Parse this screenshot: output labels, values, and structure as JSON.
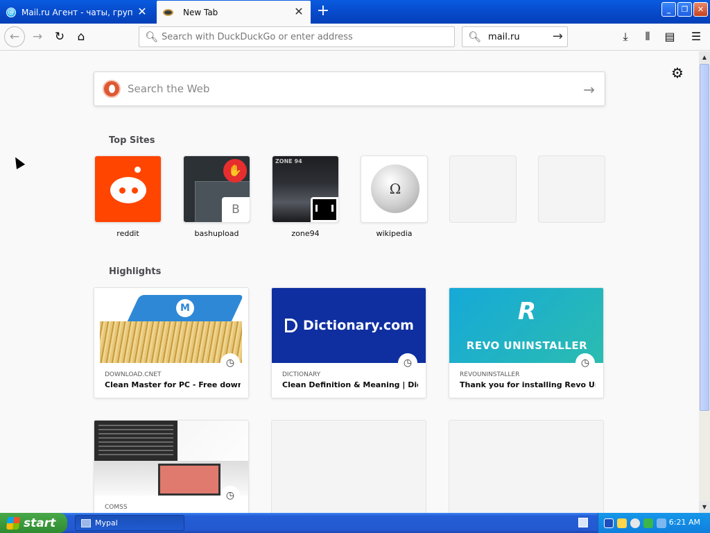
{
  "tabs": [
    {
      "title": "Mail.ru Агент - чаты, группы, ви",
      "active": false
    },
    {
      "title": "New Tab",
      "active": true
    }
  ],
  "window": {
    "minimize": "_",
    "maximize": "❐",
    "close": "✕"
  },
  "nav": {
    "url_placeholder": "Search with DuckDuckGo or enter address",
    "search_value": "mail.ru"
  },
  "content": {
    "web_search_placeholder": "Search the Web",
    "top_sites_heading": "Top Sites",
    "top_sites": [
      {
        "label": "reddit"
      },
      {
        "label": "bashupload",
        "badge": "B"
      },
      {
        "label": "zone94",
        "thumb_text": "ZONE 94"
      },
      {
        "label": "wikipedia"
      },
      {
        "label": ""
      },
      {
        "label": ""
      }
    ],
    "highlights_heading": "Highlights",
    "highlights": [
      {
        "source": "DOWNLOAD.CNET",
        "title": "Clean Master for PC - Free down..."
      },
      {
        "source": "DICTIONARY",
        "title": "Clean Definition & Meaning | Dic...",
        "image_text": "Dictionary.com"
      },
      {
        "source": "REVOUNINSTALLER",
        "title": "Thank you for installing Revo Un...",
        "image_text": "REVO UNINSTALLER"
      },
      {
        "source": "COMSS",
        "title": ""
      }
    ]
  },
  "taskbar": {
    "start": "start",
    "task": "Mypal",
    "time": "6:21 AM"
  },
  "colors": {
    "accent": "#0a5be0",
    "reddit": "#ff4500",
    "dictionary": "#0f2fa0",
    "start": "#3b9a3c"
  }
}
